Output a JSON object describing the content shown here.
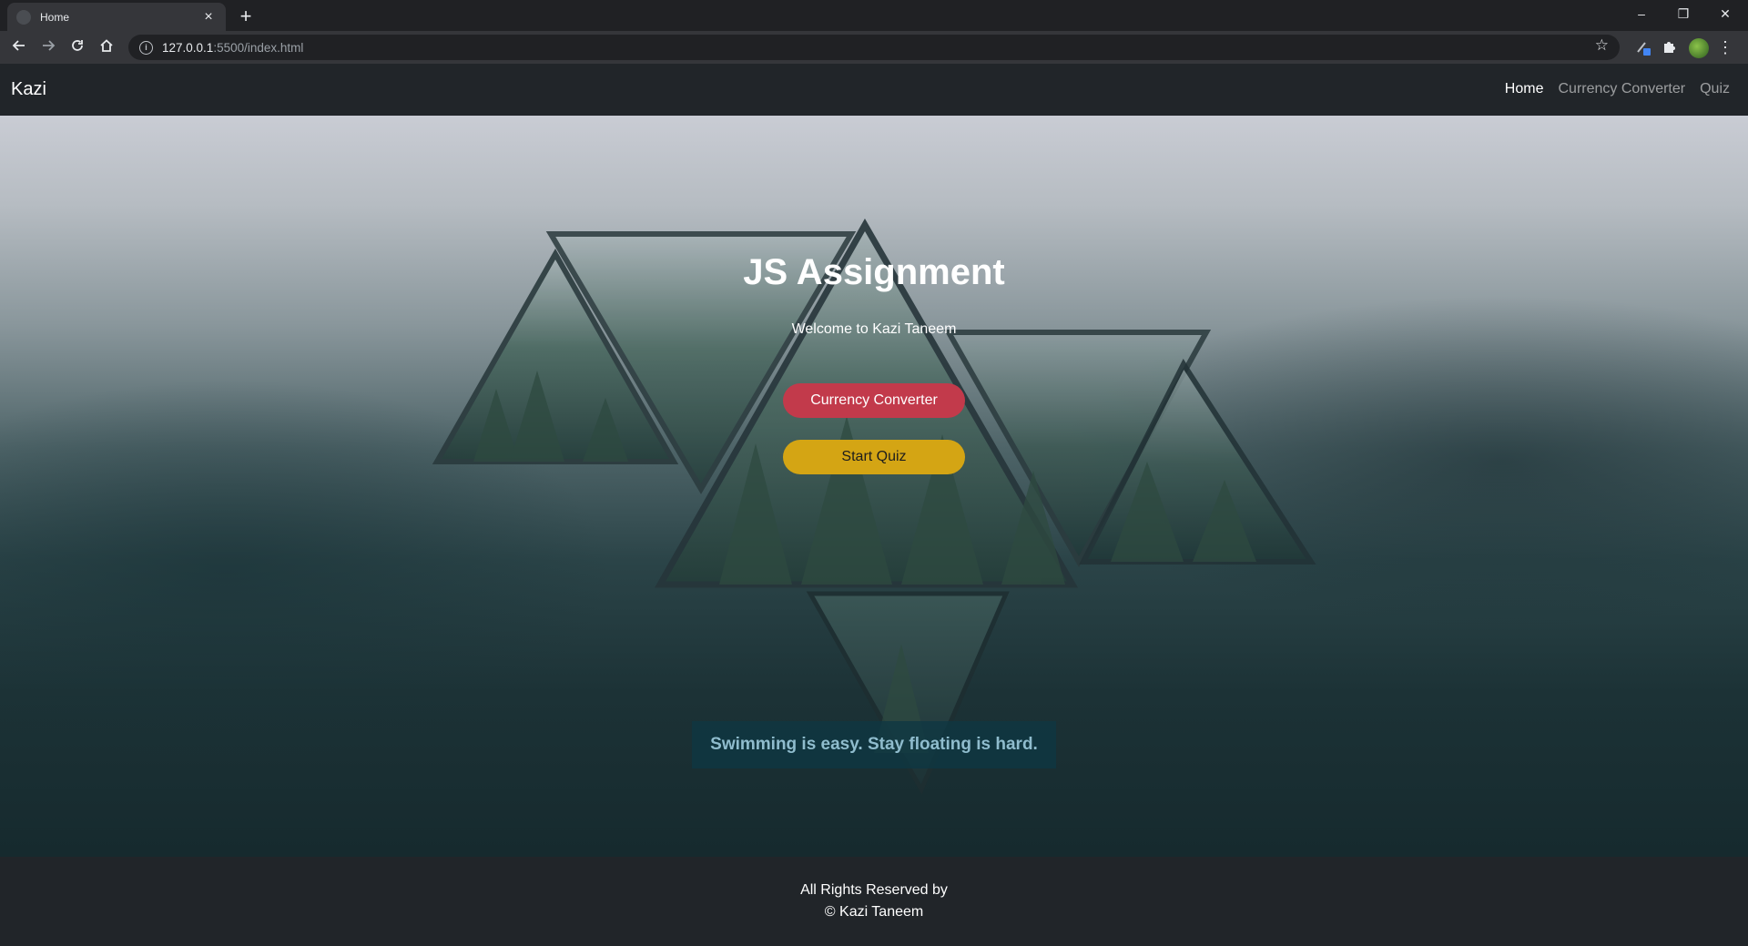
{
  "browser": {
    "tab_title": "Home",
    "tab_close": "×",
    "new_tab": "+",
    "url_host": "127.0.0.1",
    "url_path": ":5500/index.html",
    "window_controls": {
      "minimize": "–",
      "restore": "❐",
      "close": "✕"
    },
    "icons": {
      "back": "back-arrow-icon",
      "forward": "forward-arrow-icon",
      "reload": "reload-icon",
      "home": "home-icon",
      "star": "star-icon",
      "extensions": "puzzle-icon",
      "menu": "kebab-menu-icon"
    }
  },
  "navbar": {
    "brand": "Kazi",
    "links": [
      {
        "label": "Home",
        "active": true
      },
      {
        "label": "Currency Converter",
        "active": false
      },
      {
        "label": "Quiz",
        "active": false
      }
    ]
  },
  "hero": {
    "title": "JS Assignment",
    "subtitle": "Welcome to Kazi Taneem",
    "buttons": [
      {
        "label": "Currency Converter",
        "color": "#c23a4b"
      },
      {
        "label": "Start Quiz",
        "color": "#d4a514"
      }
    ],
    "quote": "Swimming is easy. Stay floating is hard."
  },
  "footer": {
    "line1": "All Rights Reserved by",
    "line2": "© Kazi Taneem"
  }
}
